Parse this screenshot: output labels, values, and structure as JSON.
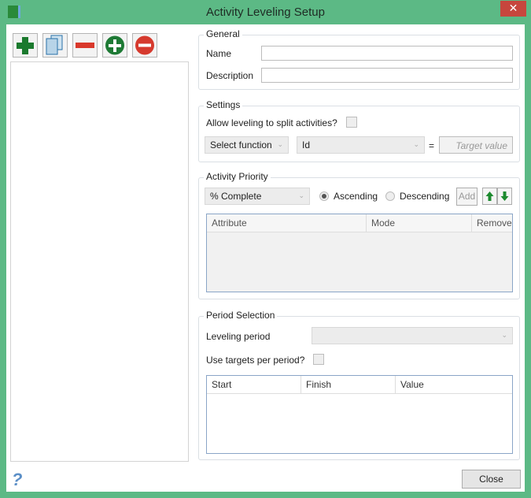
{
  "window": {
    "title": "Activity Leveling Setup",
    "close_glyph": "✕"
  },
  "toolbar": [
    "add-icon",
    "copy-icon",
    "remove-icon",
    "add-circle-icon",
    "remove-circle-icon"
  ],
  "general": {
    "legend": "General",
    "name_label": "Name",
    "name_value": "",
    "description_label": "Description",
    "description_value": ""
  },
  "settings": {
    "legend": "Settings",
    "split_label": "Allow leveling to split activities?",
    "function_value": "Select function",
    "field_value": "Id",
    "equals": "=",
    "target_placeholder": "Target value"
  },
  "priority": {
    "legend": "Activity Priority",
    "attribute_value": "% Complete",
    "ascending": "Ascending",
    "descending": "Descending",
    "add": "Add",
    "columns": [
      "Attribute",
      "Mode",
      "Remove"
    ]
  },
  "period": {
    "legend": "Period Selection",
    "leveling_label": "Leveling period",
    "leveling_value": "",
    "targets_label": "Use targets per period?",
    "columns": [
      "Start",
      "Finish",
      "Value"
    ]
  },
  "footer": {
    "close": "Close",
    "help_glyph": "?"
  }
}
